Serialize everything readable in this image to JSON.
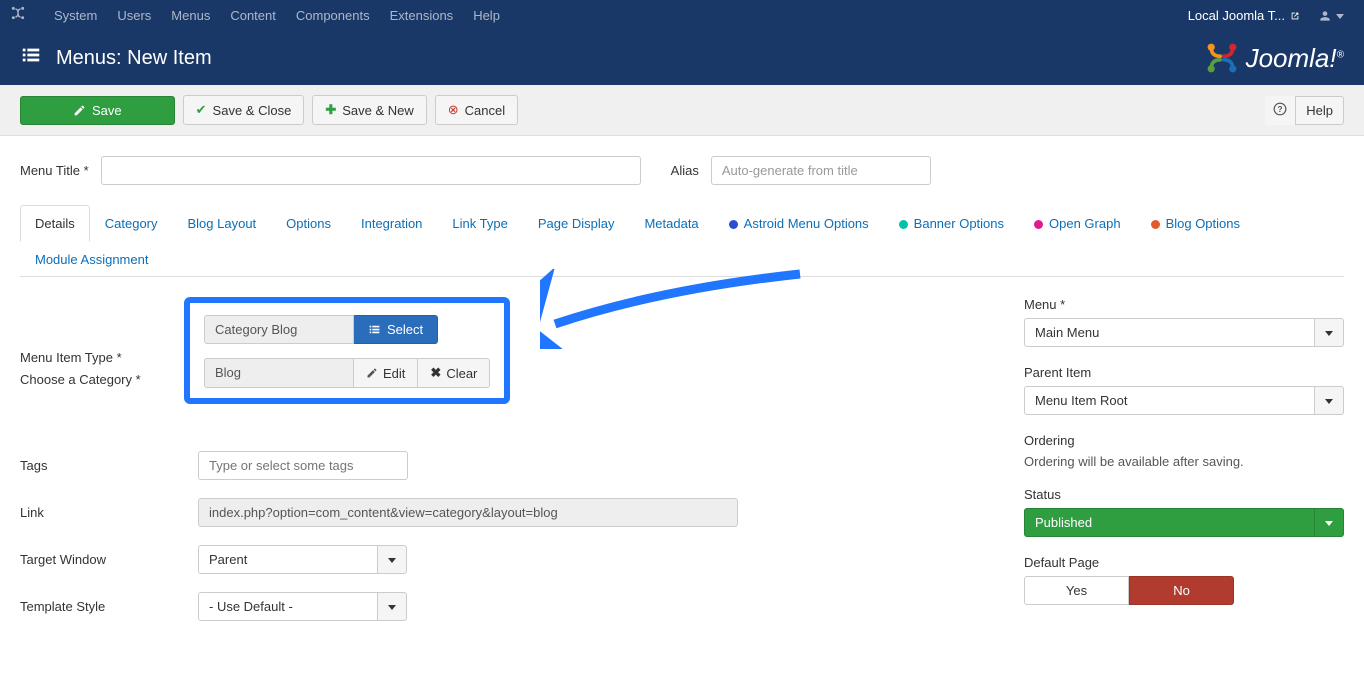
{
  "topnav": {
    "items": [
      "System",
      "Users",
      "Menus",
      "Content",
      "Components",
      "Extensions",
      "Help"
    ],
    "site_name": "Local Joomla T..."
  },
  "header": {
    "title": "Menus: New Item",
    "brand": "Joomla!"
  },
  "toolbar": {
    "save": "Save",
    "save_close": "Save & Close",
    "save_new": "Save & New",
    "cancel": "Cancel",
    "help": "Help"
  },
  "form": {
    "menu_title_label": "Menu Title *",
    "alias_label": "Alias",
    "alias_placeholder": "Auto-generate from title"
  },
  "tabs": [
    {
      "label": "Details",
      "active": true
    },
    {
      "label": "Category"
    },
    {
      "label": "Blog Layout"
    },
    {
      "label": "Options"
    },
    {
      "label": "Integration"
    },
    {
      "label": "Link Type"
    },
    {
      "label": "Page Display"
    },
    {
      "label": "Metadata"
    },
    {
      "label": "Astroid Menu Options",
      "dot": "#2a4fd0"
    },
    {
      "label": "Banner Options",
      "dot": "#00c2a8"
    },
    {
      "label": "Open Graph",
      "dot": "#e21b8c"
    },
    {
      "label": "Blog Options",
      "dot": "#e35b2a"
    },
    {
      "label": "Module Assignment"
    }
  ],
  "details": {
    "menu_item_type_label": "Menu Item Type *",
    "menu_item_type_value": "Category Blog",
    "select_btn": "Select",
    "choose_category_label": "Choose a Category *",
    "choose_category_value": "Blog",
    "edit_btn": "Edit",
    "clear_btn": "Clear",
    "tags_label": "Tags",
    "tags_placeholder": "Type or select some tags",
    "link_label": "Link",
    "link_value": "index.php?option=com_content&view=category&layout=blog",
    "target_label": "Target Window",
    "target_value": "Parent",
    "template_label": "Template Style",
    "template_value": "- Use Default -"
  },
  "sidebar": {
    "menu_label": "Menu *",
    "menu_value": "Main Menu",
    "parent_label": "Parent Item",
    "parent_value": "Menu Item Root",
    "ordering_label": "Ordering",
    "ordering_note": "Ordering will be available after saving.",
    "status_label": "Status",
    "status_value": "Published",
    "default_label": "Default Page",
    "yes": "Yes",
    "no": "No"
  }
}
